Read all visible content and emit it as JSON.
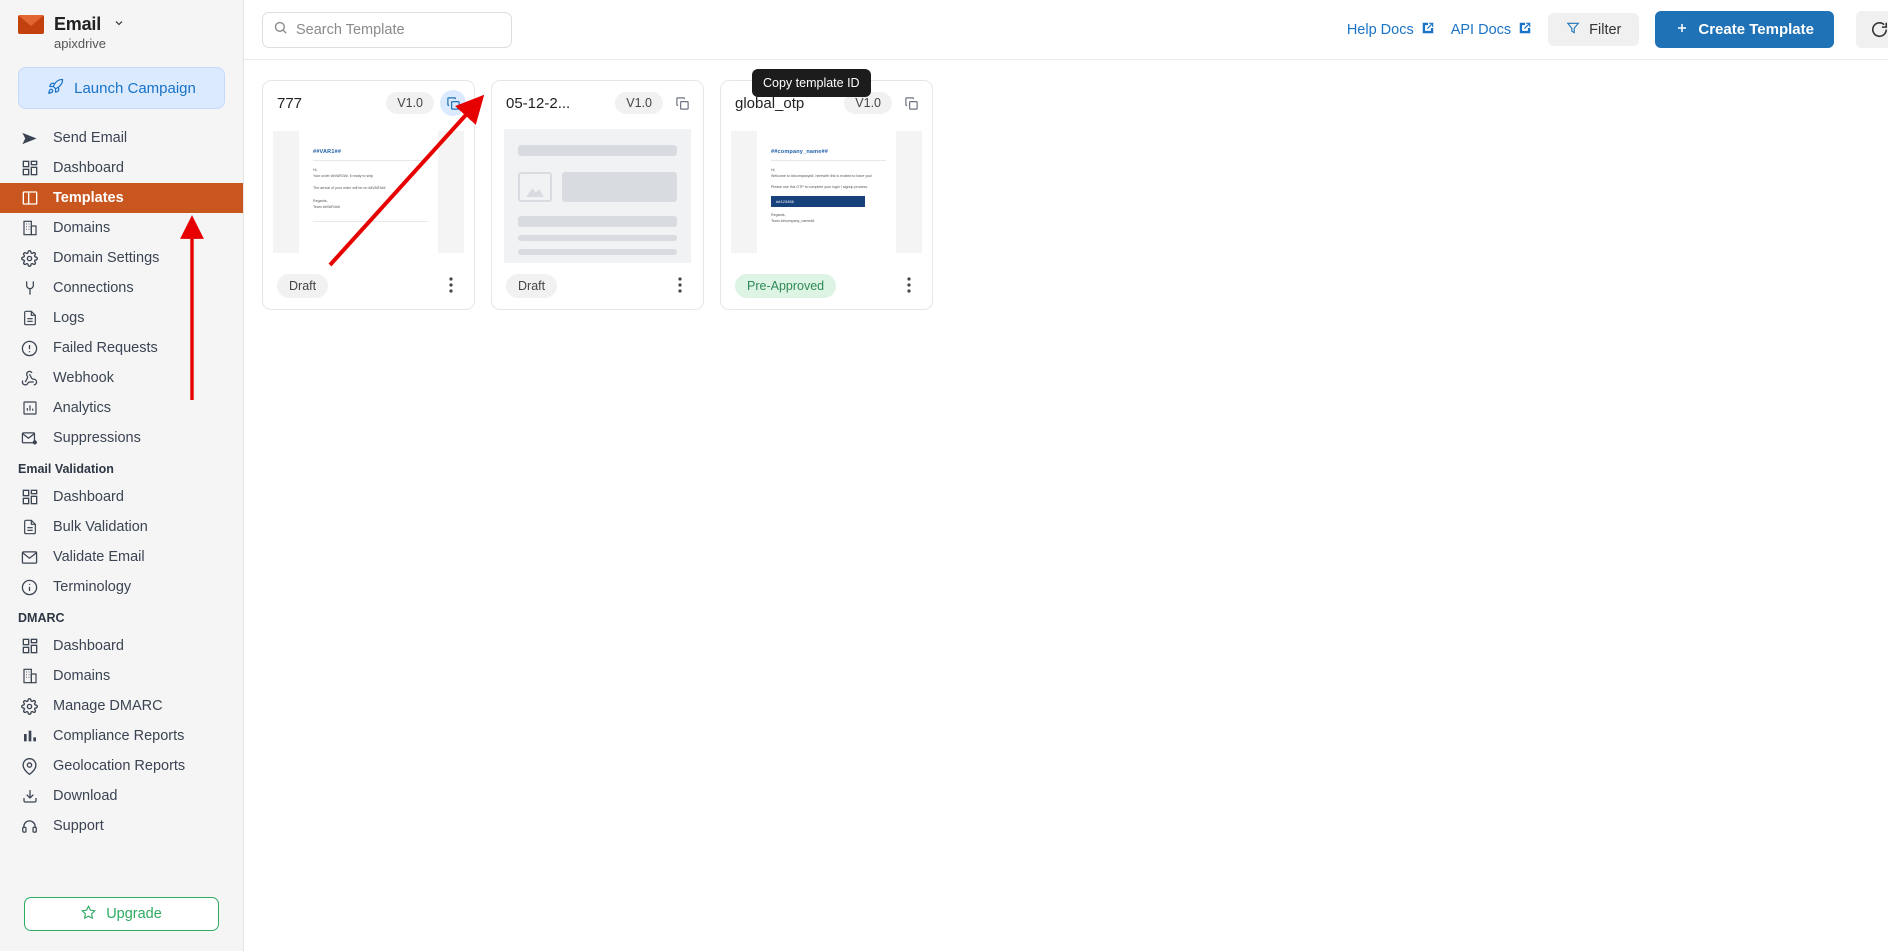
{
  "sidebar": {
    "brand": {
      "name": "Email",
      "account": "apixdrive",
      "caret": "chevron-down-icon"
    },
    "launch_button": "Launch Campaign",
    "items": [
      {
        "label": "Send Email",
        "icon": "send-icon",
        "active": false
      },
      {
        "label": "Dashboard",
        "icon": "grid-icon",
        "active": false
      },
      {
        "label": "Templates",
        "icon": "template-icon",
        "active": true
      },
      {
        "label": "Domains",
        "icon": "building-icon",
        "active": false
      },
      {
        "label": "Domain Settings",
        "icon": "gear-icon",
        "active": false
      },
      {
        "label": "Connections",
        "icon": "plug-icon",
        "active": false
      },
      {
        "label": "Logs",
        "icon": "document-icon",
        "active": false
      },
      {
        "label": "Failed Requests",
        "icon": "alert-circle-icon",
        "active": false
      },
      {
        "label": "Webhook",
        "icon": "webhook-icon",
        "active": false
      },
      {
        "label": "Analytics",
        "icon": "bar-chart-box-icon",
        "active": false
      },
      {
        "label": "Suppressions",
        "icon": "mail-block-icon",
        "active": false
      }
    ],
    "group_email_validation": {
      "title": "Email Validation",
      "items": [
        {
          "label": "Dashboard",
          "icon": "grid-icon"
        },
        {
          "label": "Bulk Validation",
          "icon": "document-icon"
        },
        {
          "label": "Validate Email",
          "icon": "mail-icon"
        },
        {
          "label": "Terminology",
          "icon": "info-circle-icon"
        }
      ]
    },
    "group_dmarc": {
      "title": "DMARC",
      "items": [
        {
          "label": "Dashboard",
          "icon": "grid-icon"
        },
        {
          "label": "Domains",
          "icon": "building-icon"
        },
        {
          "label": "Manage DMARC",
          "icon": "gear-icon"
        },
        {
          "label": "Compliance Reports",
          "icon": "bar-chart-icon"
        },
        {
          "label": "Geolocation Reports",
          "icon": "map-pin-icon"
        },
        {
          "label": "Download",
          "icon": "download-icon"
        },
        {
          "label": "Support",
          "icon": "headset-icon"
        }
      ]
    },
    "upgrade_button": "Upgrade",
    "upgrade_icon": "star-icon"
  },
  "topbar": {
    "search": {
      "placeholder": "Search Template",
      "value": "",
      "icon": "search-icon"
    },
    "help_docs": "Help Docs",
    "api_docs": "API Docs",
    "external_link_icon": "external-link-icon",
    "filter": "Filter",
    "filter_icon": "funnel-icon",
    "create_template": "Create Template",
    "create_icon": "plus-icon",
    "refresh_icon": "refresh-icon"
  },
  "tooltip": {
    "text": "Copy template ID"
  },
  "cards": [
    {
      "title": "777",
      "version": "V1.0",
      "status": "Draft",
      "status_type": "draft",
      "copy_icon": "copy-icon",
      "copy_hover": true,
      "kebab_icon": "more-vertical-icon",
      "preview_type": "email",
      "preview": {
        "heading": "##VAR1##",
        "line1": "Hi,",
        "line2": "Your order ##VAR2##, it ready to ship",
        "line3": "The arrival of your order will be on ##VAR3##",
        "line4": "Regards,",
        "line5": "Team ##VAR4##"
      }
    },
    {
      "title": "05-12-2...",
      "version": "V1.0",
      "status": "Draft",
      "status_type": "draft",
      "copy_icon": "copy-icon",
      "copy_hover": false,
      "kebab_icon": "more-vertical-icon",
      "preview_type": "skeleton"
    },
    {
      "title": "global_otp",
      "version": "V1.0",
      "status": "Pre-Approved",
      "status_type": "approved",
      "copy_icon": "copy-icon",
      "copy_hover": false,
      "kebab_icon": "more-vertical-icon",
      "preview_type": "email",
      "preview": {
        "heading": "##company_name##",
        "line1": "Hi,",
        "line2": "Welcome to ##company##, herewith link is excited to have you!",
        "line3": "Please use this OTP to complete your login / signup process.",
        "line4": "##123456",
        "line5": "Regards,",
        "line6": "Team ##company_name##"
      }
    }
  ],
  "colors": {
    "accent_orange": "#c8561e",
    "accent_blue": "#1f72b5",
    "upgrade_green": "#2eaa63",
    "annotation_red": "#e60000"
  }
}
